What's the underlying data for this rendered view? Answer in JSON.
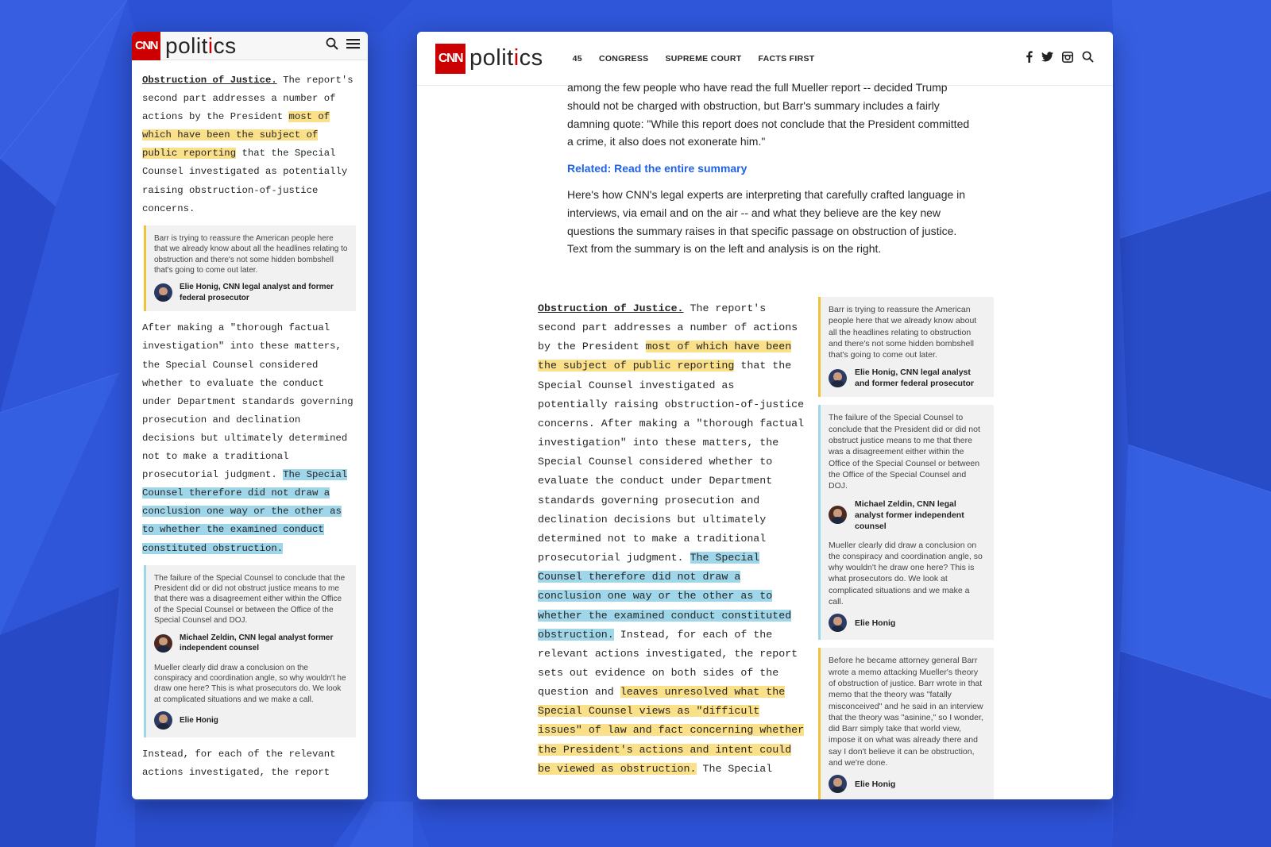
{
  "brand": {
    "cnn": "CNN",
    "section_prefix": "polit",
    "section_accent": "i",
    "section_suffix": "cs"
  },
  "colors": {
    "background": "#2f56d9",
    "brand_red": "#cc0000",
    "highlight_yellow": "#fbe08a",
    "highlight_blue": "#9fd6ea",
    "link_blue": "#2063e6"
  },
  "nav": {
    "items": [
      "45",
      "CONGRESS",
      "SUPREME COURT",
      "FACTS FIRST"
    ]
  },
  "icons": {
    "search": "search-icon",
    "menu": "hamburger-menu-icon",
    "facebook": "facebook-icon",
    "twitter": "twitter-icon",
    "instagram": "instagram-icon"
  },
  "mobile": {
    "p1_lead": "Obstruction of Justice.",
    "p1_text_a": " The report's second part addresses a number of actions by the President ",
    "p1_hl": "most of which have been the subject of public reporting",
    "p1_text_b": " that the Special Counsel investigated as potentially raising obstruction-of-justice concerns.",
    "note1_text": "Barr is trying to reassure the American people here that we already know about all the headlines relating to obstruction and there's not some hidden bombshell that's going to come out later.",
    "note1_author": "Elie Honig, CNN legal analyst and former federal prosecutor",
    "p2_text": "After making a \"thorough factual investigation\" into these matters, the Special Counsel considered whether to evaluate the conduct under Department standards governing prosecution and declination decisions but ultimately determined not to make a traditional prosecutorial judgment. ",
    "p2_hl": "The Special Counsel therefore did not draw a conclusion one way or the other as to whether the examined conduct constituted obstruction.",
    "note2_text": "The failure of the Special Counsel to conclude that the President did or did not obstruct justice means to me that there was a disagreement either within the Office of the Special Counsel or between the Office of the Special Counsel and DOJ.",
    "note2_author": "Michael Zeldin, CNN legal analyst former independent counsel",
    "note2_text2": "Mueller clearly did draw a conclusion on the conspiracy and coordination angle, so why wouldn't he draw one here? This is what prosecutors do. We look at complicated situations and we make a call.",
    "note2_author2": "Elie Honig",
    "p3_text": "Instead, for each of the relevant actions investigated, the report"
  },
  "desktop": {
    "intro_p1": "among the few people who have read the full Mueller report -- decided Trump should not be charged with obstruction, but Barr's summary includes a fairly damning quote: \"While this report does not conclude that the President committed a crime, it also does not exonerate him.\"",
    "related_link": "Related: Read the entire summary",
    "intro_p2": "Here's how CNN's legal experts are interpreting that carefully crafted language in interviews, via email and on the air -- and what they believe are the key new questions the summary raises in that specific passage on obstruction of justice. Text from the summary is on the left and analysis is on the right.",
    "body_lead": "Obstruction of Justice.",
    "body_a": " The report's second part addresses a number of actions by the President ",
    "body_hl1": "most of which have been the subject of public reporting",
    "body_b": " that the Special Counsel investigated as potentially raising obstruction-of-justice concerns. After making a \"thorough factual investigation\" into these matters, the Special Counsel considered whether to evaluate the conduct under Department standards governing prosecution and declination decisions but ultimately determined not to make a traditional prosecutorial judgment. ",
    "body_hl2": "The Special Counsel therefore did not draw a conclusion one way or the other as to whether the examined conduct constituted obstruction.",
    "body_c": " Instead, for each of the relevant actions investigated, the report sets out evidence on both sides of the question and ",
    "body_hl3": "leaves unresolved what the Special Counsel views as \"difficult issues\" of law and fact concerning whether the President's actions and intent could be viewed as obstruction.",
    "body_d": " The Special",
    "note1_text": "Barr is trying to reassure the American people here that we already know about all the headlines relating to obstruction and there's not some hidden bombshell that's going to come out later.",
    "note1_author": "Elie Honig, CNN legal analyst and former federal prosecutor",
    "note2_text": "The failure of the Special Counsel to conclude that the President did or did not obstruct justice means to me that there was a disagreement either within the Office of the Special Counsel or between the Office of the Special Counsel and DOJ.",
    "note2_author": "Michael Zeldin, CNN legal analyst former independent counsel",
    "note2_text2": "Mueller clearly did draw a conclusion on the conspiracy and coordination angle, so why wouldn't he draw one here? This is what prosecutors do. We look at complicated situations and we make a call.",
    "note2_author2": "Elie Honig",
    "note3_text": "Before he became attorney general Barr wrote a memo attacking Mueller's theory of obstruction of justice. Barr wrote in that memo that the theory was \"fatally misconceived\" and he said in an interview that the theory was \"asinine,\" so I wonder, did Barr simply take that world view, impose it on what was already there and say I don't believe it can be obstruction, and we're done.",
    "note3_author": "Elie Honig"
  }
}
